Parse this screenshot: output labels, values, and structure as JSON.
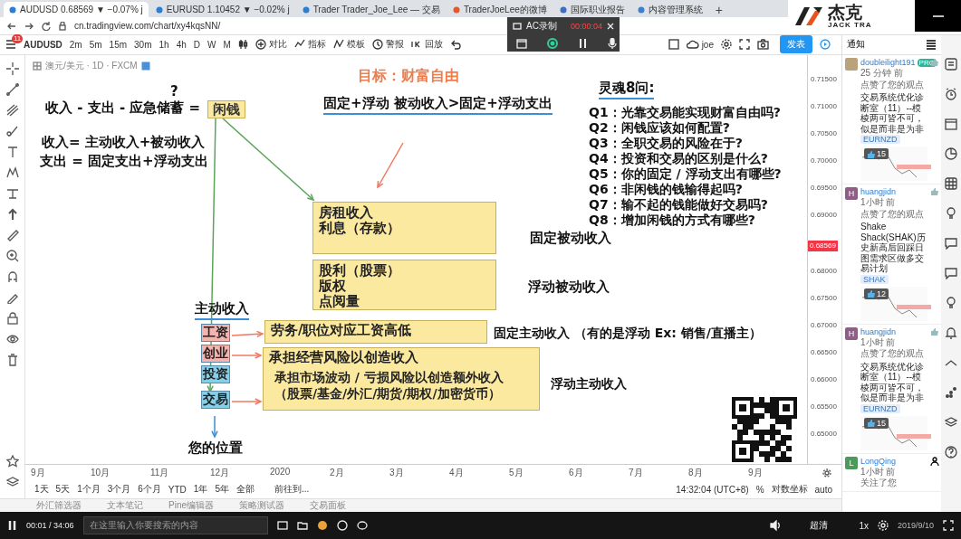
{
  "browser": {
    "tabs": [
      {
        "title": "AUDUSD 0.68569 ▼ −0.07% j",
        "selected": true
      },
      {
        "title": "EURUSD 1.10452 ▼ −0.02% j",
        "selected": false
      },
      {
        "title": "Trader Trader_Joe_Lee — 交易",
        "selected": false
      },
      {
        "title": "TraderJoeLee的微博",
        "selected": false
      },
      {
        "title": "国际职业报告",
        "selected": false
      },
      {
        "title": "内容管理系统",
        "selected": false
      }
    ],
    "new_tab": "+",
    "url": "cn.tradingview.com/chart/xy4kqsNN/"
  },
  "recorder": {
    "title": "AC录制",
    "time": "00:00:04"
  },
  "logo": {
    "name": "杰克",
    "subtitle": "JACK TRA"
  },
  "toolbar": {
    "badge": "11",
    "symbol": "AUDUSD",
    "intervals": [
      "2m",
      "5m",
      "15m",
      "30m",
      "1h",
      "4h",
      "D",
      "W",
      "M"
    ],
    "tools": [
      "对比",
      "指标",
      "模板",
      "警报",
      "回放"
    ],
    "user": "joe",
    "publish": "发表"
  },
  "legend": "澳元/美元 · 1D · FXCM",
  "drawing": {
    "goal": "目标：财富自由",
    "formula": "固定+浮动 被动收入>固定+浮动支出",
    "questions_title": "灵魂8问:",
    "questions": [
      "Q1：光靠交易能实现财富自由吗?",
      "Q2：闲钱应该如何配置?",
      "Q3：全职交易的风险在于?",
      "Q4：投资和交易的区别是什么?",
      "Q5：你的固定 / 浮动支出有哪些?",
      "Q6：非闲钱的钱输得起吗?",
      "Q7：输不起的钱能做好交易吗?",
      "Q8：增加闲钱的方式有哪些?"
    ],
    "question_mark": "?",
    "equation": "收入 - 支出 - 应急储蓄 =",
    "idle_money": "闲钱",
    "income_def": "收入= 主动收入+被动收入",
    "expense_def": "支出 = 固定支出+浮动支出",
    "passive_groups": [
      {
        "items": [
          "房租收入",
          "利息（存款）"
        ],
        "label": "固定被动收入"
      },
      {
        "items": [
          "股利（股票）",
          "版权",
          "点阅量"
        ],
        "label": "浮动被动收入"
      }
    ],
    "active_title": "主动收入",
    "active_sources": [
      {
        "label": "工资",
        "color": "#f4b3ae"
      },
      {
        "label": "创业",
        "color": "#f4b3ae"
      },
      {
        "label": "投资",
        "color": "#86cfe8"
      },
      {
        "label": "交易",
        "color": "#86cfe8"
      }
    ],
    "active_notes": [
      {
        "lines": [
          "劳务/职位对应工资高低"
        ],
        "label": "固定主动收入 （有的是浮动 Ex: 销售/直播主）"
      },
      {
        "lines": [
          "承担经营风险以创造收入",
          "承担市场波动 / 亏损风险以创造额外收入",
          "（股票/基金/外汇/期货/期权/加密货币）"
        ],
        "label": "浮动主动收入"
      }
    ],
    "position": "您的位置"
  },
  "price_scale": {
    "ticks": [
      "0.71500",
      "0.71000",
      "0.70500",
      "0.70000",
      "0.69500",
      "0.69000",
      "0.68000",
      "0.67500",
      "0.67000",
      "0.66500",
      "0.66000",
      "0.65500",
      "0.65000"
    ],
    "current": "0.68569"
  },
  "time_axis": [
    "9月",
    "10月",
    "11月",
    "12月",
    "2020",
    "2月",
    "3月",
    "4月",
    "5月",
    "6月",
    "7月",
    "8月",
    "9月"
  ],
  "ranges": [
    "1天",
    "5天",
    "1个月",
    "3个月",
    "6个月",
    "YTD",
    "1年",
    "5年",
    "全部"
  ],
  "goto": "前往到...",
  "clock": "14:32:04 (UTC+8)",
  "percent": "%",
  "log_scale": "对数坐标",
  "auto": "auto",
  "bottom_tabs": [
    "外汇筛选器",
    "文本笔记",
    "Pine编辑器",
    "策略测试器",
    "交易面板"
  ],
  "notifications": {
    "title": "通知",
    "items": [
      {
        "kind": "idea",
        "color": "#b9a27c",
        "user": "doubleilight191",
        "pro": "PRO",
        "time": "25 分钟 前",
        "action": "点赞了您的观点",
        "text": "交易系统优化诊断室（11）--模棱两可皆不可，似是而非是为非",
        "tag": "EURNZD",
        "likes": "15"
      },
      {
        "kind": "idea",
        "avatar": "H",
        "color": "#8e5e86",
        "user": "huangjidn",
        "time": "1小时 前",
        "action": "点赞了您的观点",
        "text": "Shake Shack(SHAK)历史新高后回踩日图需求区做多交易计划",
        "tag": "SHAK",
        "likes": "12"
      },
      {
        "kind": "idea",
        "avatar": "H",
        "color": "#8e5e86",
        "user": "huangjidn",
        "time": "1小时 前",
        "action": "点赞了您的观点",
        "text": "交易系统优化诊断室（11）--模棱两可皆不可，似是而非是为非",
        "tag": "EURNZD",
        "likes": "15"
      },
      {
        "kind": "follow",
        "avatar": "L",
        "color": "#4c9a5a",
        "user": "LongQing",
        "time": "1小时 前",
        "action": "关注了您"
      }
    ]
  },
  "player": {
    "time": "00:01 / 34:06",
    "search_placeholder": "在这里输入你要搜索的内容",
    "quality": "超清",
    "speed": "1x",
    "date": "2019/9/10"
  }
}
